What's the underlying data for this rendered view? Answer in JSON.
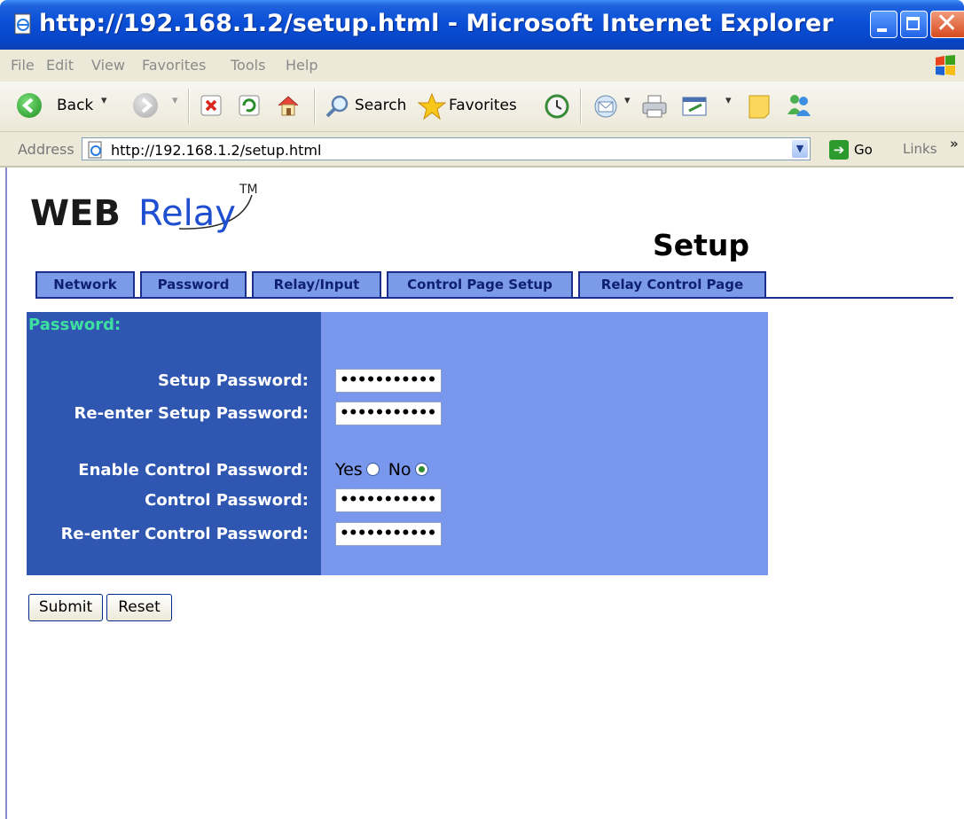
{
  "window": {
    "title": "http://192.168.1.2/setup.html - Microsoft Internet Explorer"
  },
  "menu": [
    "File",
    "Edit",
    "View",
    "Favorites",
    "Tools",
    "Help"
  ],
  "toolbar": {
    "back_label": "Back",
    "search_label": "Search",
    "favorites_label": "Favorites"
  },
  "address": {
    "label": "Address",
    "url": "http://192.168.1.2/setup.html",
    "go_label": "Go",
    "links_label": "Links",
    "links_more": "»"
  },
  "page": {
    "logo_web": "WEB",
    "logo_relay": "Relay",
    "logo_tm": "TM",
    "title": "Setup",
    "tabs": [
      "Network",
      "Password",
      "Relay/Input",
      "Control Page Setup",
      "Relay Control Page"
    ],
    "section_title": "Password:",
    "fields": {
      "setup_password_label": "Setup Password:",
      "reenter_setup_label": "Re-enter Setup Password:",
      "enable_control_label": "Enable Control Password:",
      "control_password_label": "Control Password:",
      "reenter_control_label": "Re-enter Control Password:",
      "masked_value": "•••••••••••"
    },
    "enable_control": {
      "yes_label": "Yes",
      "no_label": "No",
      "selected": "No"
    },
    "buttons": {
      "submit": "Submit",
      "reset": "Reset"
    }
  },
  "colors": {
    "titlebar": "#0a4fd6",
    "panel_left": "#2f56b0",
    "panel_right": "#7997ec",
    "tab_bg": "#7b9be9",
    "section_title": "#3ee0a0"
  }
}
